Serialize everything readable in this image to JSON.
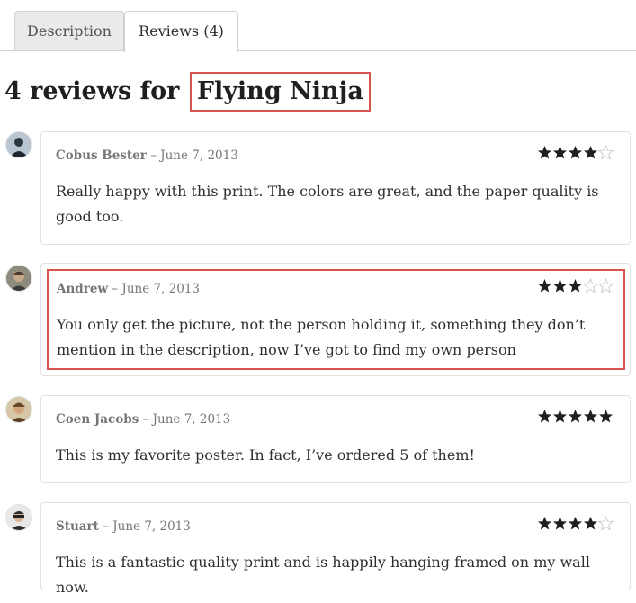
{
  "tabs": [
    {
      "label": "Description"
    },
    {
      "label": "Reviews (4)"
    }
  ],
  "heading": {
    "prefix": "4 reviews for",
    "product": "Flying Ninja"
  },
  "reviews": [
    {
      "author": "Cobus Bester",
      "separator": "–",
      "date": "June 7, 2013",
      "rating": 4,
      "text": "Really happy with this print. The colors are great, and the paper quality is good too."
    },
    {
      "author": "Andrew",
      "separator": "–",
      "date": "June 7, 2013",
      "rating": 3,
      "text": "You only get the picture, not the person holding it, something they don’t mention in the description, now I’ve got to find my own person"
    },
    {
      "author": "Coen Jacobs",
      "separator": "–",
      "date": "June 7, 2013",
      "rating": 5,
      "text": "This is my favorite poster. In fact, I’ve ordered 5 of them!"
    },
    {
      "author": "Stuart",
      "separator": "–",
      "date": "June 7, 2013",
      "rating": 4,
      "text": "This is a fantastic quality print and is happily hanging framed on my wall now."
    }
  ],
  "colors": {
    "star_filled": "#1f1f1f",
    "star_empty": "#cccccc",
    "highlight": "#d9534f"
  }
}
